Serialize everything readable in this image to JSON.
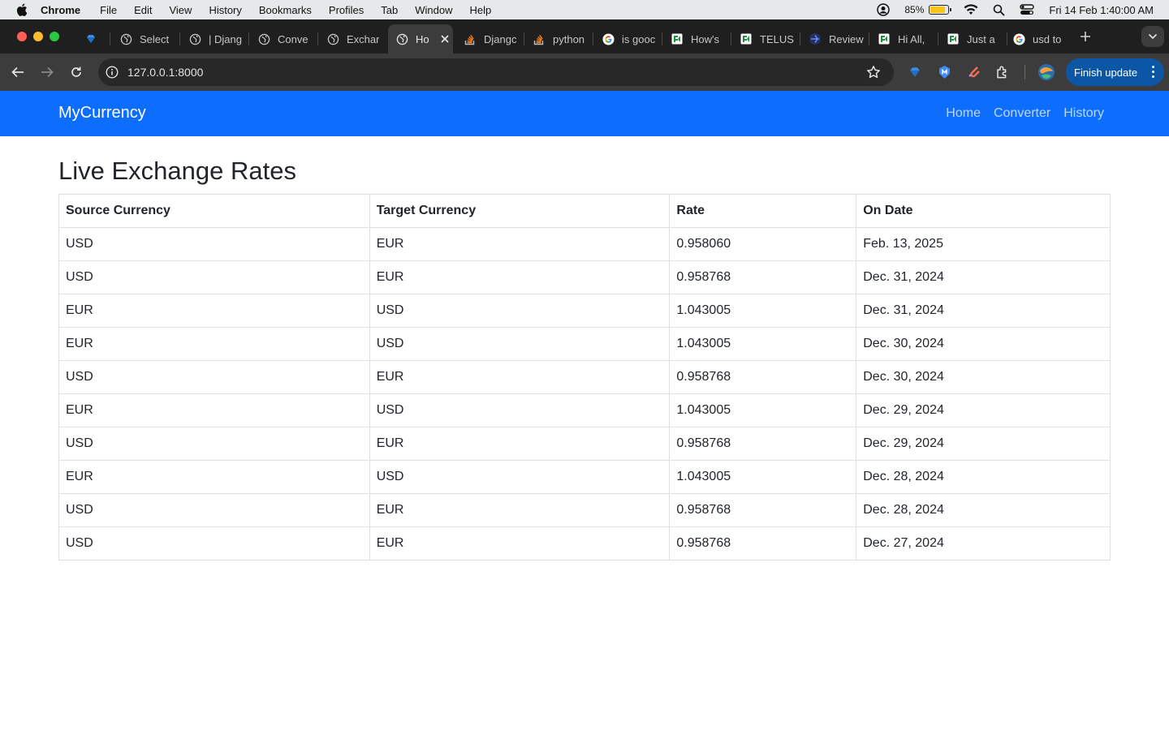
{
  "menubar": {
    "app_name": "Chrome",
    "items": [
      "File",
      "Edit",
      "View",
      "History",
      "Bookmarks",
      "Profiles",
      "Tab",
      "Window",
      "Help"
    ],
    "battery_percent": "85%",
    "battery_level": 0.85,
    "datetime": "Fri 14 Feb  1:40:00 AM"
  },
  "browser": {
    "tabs": [
      {
        "title": "",
        "icon": "gem-icon"
      },
      {
        "title": "Select",
        "icon": "globe-icon"
      },
      {
        "title": "| Djang",
        "icon": "globe-icon"
      },
      {
        "title": "Conve",
        "icon": "globe-icon"
      },
      {
        "title": "Exchar",
        "icon": "globe-icon"
      },
      {
        "title": "Ho",
        "icon": "globe-icon",
        "active": true
      },
      {
        "title": "Djangc",
        "icon": "stackoverflow-icon"
      },
      {
        "title": "python",
        "icon": "stackoverflow-icon"
      },
      {
        "title": "is gooc",
        "icon": "google-icon"
      },
      {
        "title": "How's",
        "icon": "sheet-icon"
      },
      {
        "title": "TELUS",
        "icon": "sheet-icon"
      },
      {
        "title": "Review",
        "icon": "review-icon"
      },
      {
        "title": "Hi All,",
        "icon": "sheet-icon"
      },
      {
        "title": "Just a",
        "icon": "sheet-icon"
      },
      {
        "title": "usd to",
        "icon": "google-icon"
      }
    ],
    "url": "127.0.0.1:8000",
    "finish_update_label": "Finish update",
    "colors": {
      "accent": "#0b57a5",
      "toolbar": "#3c3c3c",
      "tabstrip": "#1f1f1f"
    }
  },
  "navbar": {
    "brand": "MyCurrency",
    "links": [
      "Home",
      "Converter",
      "History"
    ],
    "color": "#0d6efd"
  },
  "main": {
    "title": "Live Exchange Rates",
    "table": {
      "headers": [
        "Source Currency",
        "Target Currency",
        "Rate",
        "On Date"
      ],
      "rows": [
        [
          "USD",
          "EUR",
          "0.958060",
          "Feb. 13, 2025"
        ],
        [
          "USD",
          "EUR",
          "0.958768",
          "Dec. 31, 2024"
        ],
        [
          "EUR",
          "USD",
          "1.043005",
          "Dec. 31, 2024"
        ],
        [
          "EUR",
          "USD",
          "1.043005",
          "Dec. 30, 2024"
        ],
        [
          "USD",
          "EUR",
          "0.958768",
          "Dec. 30, 2024"
        ],
        [
          "EUR",
          "USD",
          "1.043005",
          "Dec. 29, 2024"
        ],
        [
          "USD",
          "EUR",
          "0.958768",
          "Dec. 29, 2024"
        ],
        [
          "EUR",
          "USD",
          "1.043005",
          "Dec. 28, 2024"
        ],
        [
          "USD",
          "EUR",
          "0.958768",
          "Dec. 28, 2024"
        ],
        [
          "USD",
          "EUR",
          "0.958768",
          "Dec. 27, 2024"
        ]
      ]
    }
  }
}
